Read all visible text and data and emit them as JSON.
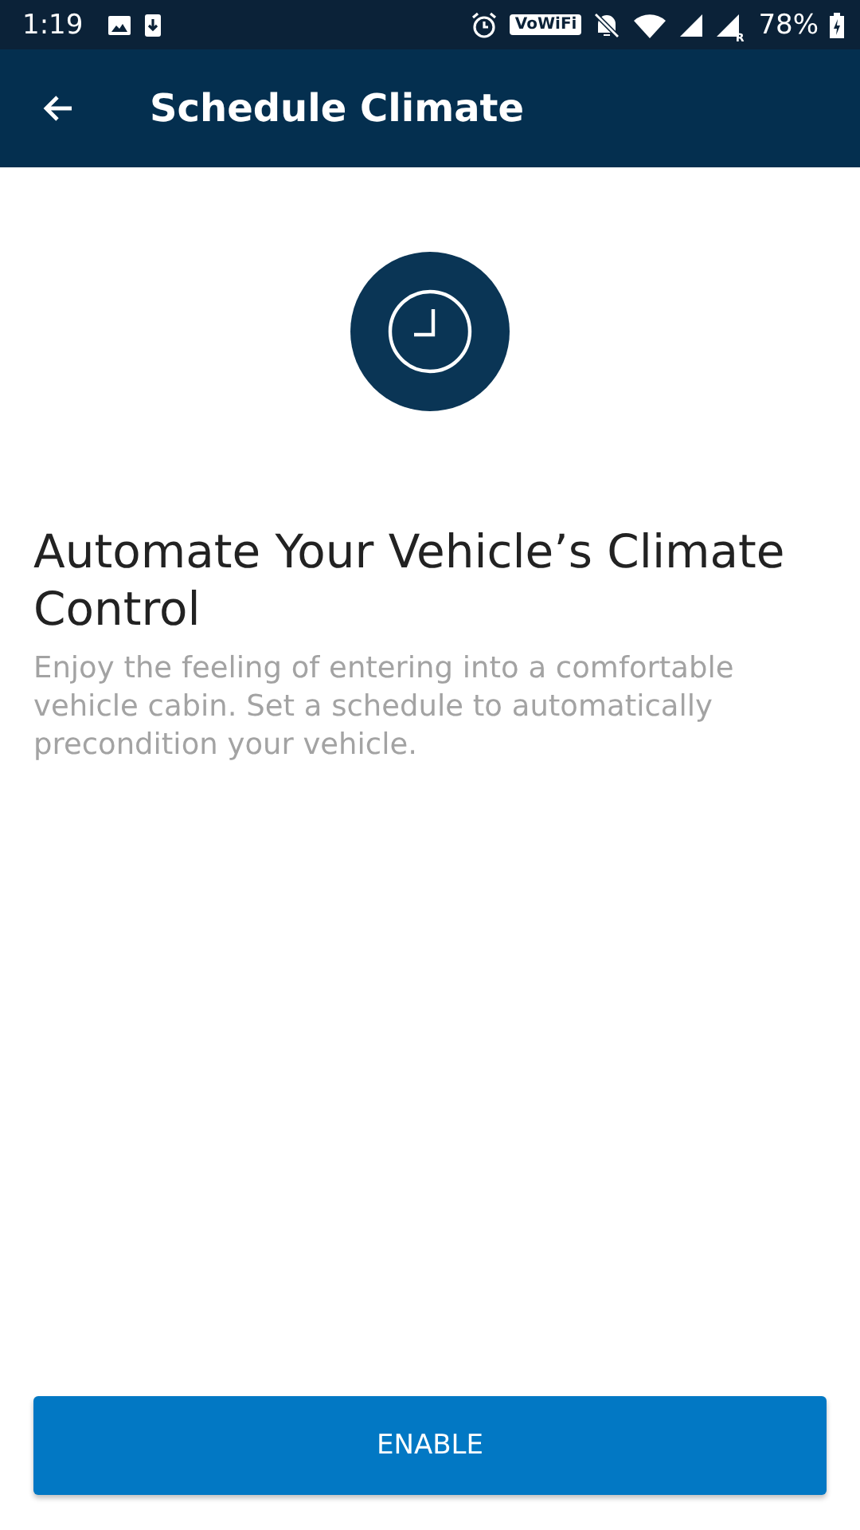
{
  "status_bar": {
    "time": "1:19",
    "wifi_calling": "VoWiFi",
    "roaming": "R",
    "battery": "78%"
  },
  "app_bar": {
    "title": "Schedule Climate"
  },
  "heading": "Automate Your Vehicle’s Climate Control",
  "description": "Enjoy the feeling of entering into a comfortable vehicle cabin. Set a schedule to automatically precondition your vehicle.",
  "button": "ENABLE"
}
